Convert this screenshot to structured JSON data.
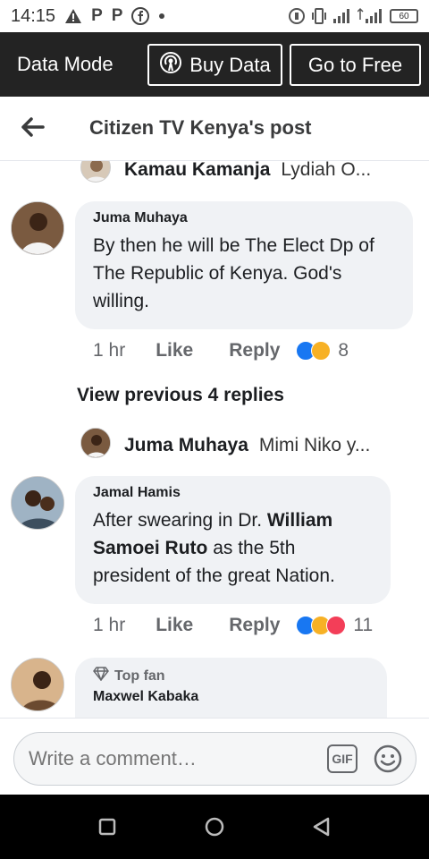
{
  "status_bar": {
    "time": "14:15",
    "notif_icons": [
      "warning-icon",
      "p-app-icon",
      "p-app-icon",
      "facebook-icon",
      "dot-icon"
    ],
    "notif_p": "P",
    "battery": "60"
  },
  "data_bar": {
    "mode_label": "Data Mode",
    "buy_label": "Buy Data",
    "free_label": "Go to Free"
  },
  "header": {
    "title": "Citizen TV Kenya's post"
  },
  "feed": {
    "reply_preview_1": {
      "name": "Kamau Kamanja",
      "text": "Lydiah O..."
    },
    "comment_1": {
      "author": "Juma Muhaya",
      "body": "By then he will be The Elect Dp of The Republic of Kenya. God's willing.",
      "time": "1 hr",
      "like": "Like",
      "reply": "Reply",
      "reaction_count": "8"
    },
    "view_previous": "View previous 4 replies",
    "reply_preview_2": {
      "name": "Juma Muhaya",
      "text": "Mimi Niko y..."
    },
    "comment_2": {
      "author": "Jamal Hamis",
      "body_pre": "After swearing in Dr. ",
      "body_bold": "William Samoei Ruto",
      "body_post": " as the 5th president of the great Nation.",
      "time": "1 hr",
      "like": "Like",
      "reply": "Reply",
      "reaction_count": "11"
    },
    "comment_3": {
      "badge": "Top fan",
      "author": "Maxwel Kabaka"
    }
  },
  "composer": {
    "placeholder": "Write a comment…",
    "gif_label": "GIF"
  },
  "colors": {
    "data_bar_bg": "#232323",
    "bubble_bg": "#f0f2f5",
    "like_blue": "#1877f2",
    "haha_yellow": "#f7b125",
    "love_red": "#f33e58"
  }
}
